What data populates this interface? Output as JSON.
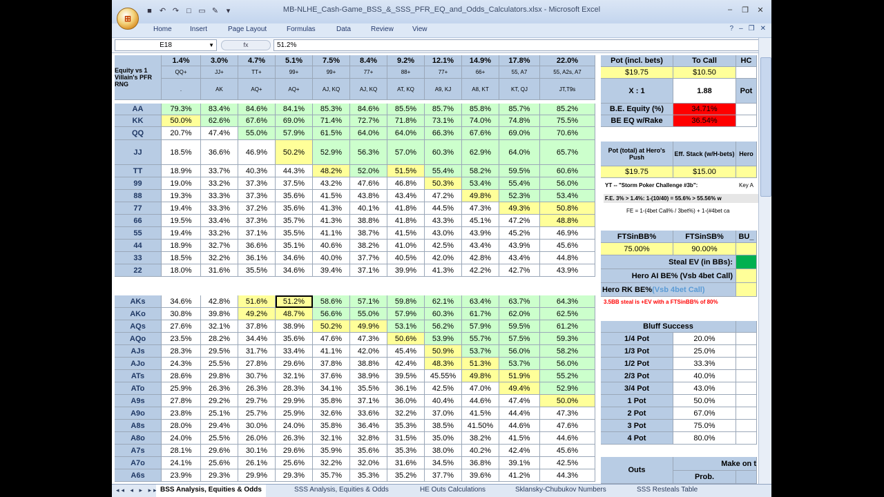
{
  "window": {
    "title": "MB-NLHE_Cash-Game_BSS_&_SSS_PFR_EQ_and_Odds_Calculators.xlsx - Microsoft Excel",
    "office_button": "⊞",
    "minimize": "–",
    "restore": "❐",
    "close": "✕"
  },
  "ribbon": {
    "tabs": [
      "Home",
      "Insert",
      "Page Layout",
      "Formulas",
      "Data",
      "Review",
      "View"
    ],
    "help": "?",
    "ribbon_min": "–",
    "ribbon_restore": "❐",
    "ribbon_close": "✕"
  },
  "formula_bar": {
    "name_box": "E18",
    "fx": "fx",
    "value": "51.2%"
  },
  "main_table": {
    "header_label": "Equity vs 1 Villain's PFR RNG",
    "columns": [
      {
        "pct": "1.4%",
        "r1": "QQ+",
        "r2": "."
      },
      {
        "pct": "3.0%",
        "r1": "JJ+",
        "r2": "AK"
      },
      {
        "pct": "4.7%",
        "r1": "TT+",
        "r2": "AQ+"
      },
      {
        "pct": "5.1%",
        "r1": "99+",
        "r2": "AQ+"
      },
      {
        "pct": "7.5%",
        "r1": "99+",
        "r2": "AJ, KQ"
      },
      {
        "pct": "8.4%",
        "r1": "77+",
        "r2": "AJ, KQ"
      },
      {
        "pct": "9.2%",
        "r1": "88+",
        "r2": "AT, KQ"
      },
      {
        "pct": "12.1%",
        "r1": "77+",
        "r2": "A9, KJ"
      },
      {
        "pct": "14.9%",
        "r1": "66+",
        "r2": "A8, KT"
      },
      {
        "pct": "17.8%",
        "r1": "55, A7",
        "r2": "KT, QJ"
      },
      {
        "pct": "22.0%",
        "r1": "55, A2s, A7",
        "r2": "JT,T9s"
      }
    ],
    "pairs": [
      {
        "hand": "AA",
        "vals": [
          "79.3%",
          "83.4%",
          "84.6%",
          "84.1%",
          "85.3%",
          "84.6%",
          "85.5%",
          "85.7%",
          "85.8%",
          "85.7%",
          "85.2%"
        ],
        "cls": "gggggggggggg"
      },
      {
        "hand": "KK",
        "vals": [
          "50.0%",
          "62.6%",
          "67.6%",
          "69.0%",
          "71.4%",
          "72.7%",
          "71.8%",
          "73.1%",
          "74.0%",
          "74.8%",
          "75.5%"
        ],
        "cls": "ygggggggggg"
      },
      {
        "hand": "QQ",
        "vals": [
          "20.7%",
          "47.4%",
          "55.0%",
          "57.9%",
          "61.5%",
          "64.0%",
          "64.0%",
          "66.3%",
          "67.6%",
          "69.0%",
          "70.6%"
        ],
        "cls": "wwggggggggg"
      },
      {
        "hand": "JJ",
        "vals": [
          "18.5%",
          "36.6%",
          "46.9%",
          "50.2%",
          "52.9%",
          "56.3%",
          "57.0%",
          "60.3%",
          "62.9%",
          "64.0%",
          "65.7%"
        ],
        "cls": "wwwyggggggg"
      },
      {
        "hand": "TT",
        "vals": [
          "18.9%",
          "33.7%",
          "40.3%",
          "44.3%",
          "48.2%",
          "52.0%",
          "51.5%",
          "55.4%",
          "58.2%",
          "59.5%",
          "60.6%"
        ],
        "cls": "wwwwygyggggg"
      },
      {
        "hand": "99",
        "vals": [
          "19.0%",
          "33.2%",
          "37.3%",
          "37.5%",
          "43.2%",
          "47.6%",
          "46.8%",
          "50.3%",
          "53.4%",
          "55.4%",
          "56.0%"
        ],
        "cls": "wwwwwwwyggg"
      },
      {
        "hand": "88",
        "vals": [
          "19.3%",
          "33.3%",
          "37.3%",
          "35.6%",
          "41.5%",
          "43.8%",
          "43.4%",
          "47.2%",
          "49.8%",
          "52.3%",
          "53.4%"
        ],
        "cls": "wwwwwwwwygg"
      },
      {
        "hand": "77",
        "vals": [
          "19.4%",
          "33.3%",
          "37.2%",
          "35.6%",
          "41.3%",
          "40.1%",
          "41.8%",
          "44.5%",
          "47.3%",
          "49.3%",
          "50.8%"
        ],
        "cls": "wwwwwwwwwyy"
      },
      {
        "hand": "66",
        "vals": [
          "19.5%",
          "33.4%",
          "37.3%",
          "35.7%",
          "41.3%",
          "38.8%",
          "41.8%",
          "43.3%",
          "45.1%",
          "47.2%",
          "48.8%"
        ],
        "cls": "wwwwwwwwwwy"
      },
      {
        "hand": "55",
        "vals": [
          "19.4%",
          "33.2%",
          "37.1%",
          "35.5%",
          "41.1%",
          "38.7%",
          "41.5%",
          "43.0%",
          "43.9%",
          "45.2%",
          "46.9%"
        ],
        "cls": "wwwwwwwwwww"
      },
      {
        "hand": "44",
        "vals": [
          "18.9%",
          "32.7%",
          "36.6%",
          "35.1%",
          "40.6%",
          "38.2%",
          "41.0%",
          "42.5%",
          "43.4%",
          "43.9%",
          "45.6%"
        ],
        "cls": "wwwwwwwwwww"
      },
      {
        "hand": "33",
        "vals": [
          "18.5%",
          "32.2%",
          "36.1%",
          "34.6%",
          "40.0%",
          "37.7%",
          "40.5%",
          "42.0%",
          "42.8%",
          "43.4%",
          "44.8%"
        ],
        "cls": "wwwwwwwwwww"
      },
      {
        "hand": "22",
        "vals": [
          "18.0%",
          "31.6%",
          "35.5%",
          "34.6%",
          "39.4%",
          "37.1%",
          "39.9%",
          "41.3%",
          "42.2%",
          "42.7%",
          "43.9%"
        ],
        "cls": "wwwwwwwwwww"
      }
    ],
    "aces": [
      {
        "hand": "AKs",
        "vals": [
          "34.6%",
          "42.8%",
          "51.6%",
          "51.2%",
          "58.6%",
          "57.1%",
          "59.8%",
          "62.1%",
          "63.4%",
          "63.7%",
          "64.3%"
        ],
        "cls": "wwyyggggggg"
      },
      {
        "hand": "AKo",
        "vals": [
          "30.8%",
          "39.8%",
          "49.2%",
          "48.7%",
          "56.6%",
          "55.0%",
          "57.9%",
          "60.3%",
          "61.7%",
          "62.0%",
          "62.5%"
        ],
        "cls": "wwyyggggggg"
      },
      {
        "hand": "AQs",
        "vals": [
          "27.6%",
          "32.1%",
          "37.8%",
          "38.9%",
          "50.2%",
          "49.9%",
          "53.1%",
          "56.2%",
          "57.9%",
          "59.5%",
          "61.2%"
        ],
        "cls": "wwwwyyggggg"
      },
      {
        "hand": "AQo",
        "vals": [
          "23.5%",
          "28.2%",
          "34.4%",
          "35.6%",
          "47.6%",
          "47.3%",
          "50.6%",
          "53.9%",
          "55.7%",
          "57.5%",
          "59.3%"
        ],
        "cls": "wwwwwwygggg"
      },
      {
        "hand": "AJs",
        "vals": [
          "28.3%",
          "29.5%",
          "31.7%",
          "33.4%",
          "41.1%",
          "42.0%",
          "45.4%",
          "50.9%",
          "53.7%",
          "56.0%",
          "58.2%"
        ],
        "cls": "wwwwwwwyggg"
      },
      {
        "hand": "AJo",
        "vals": [
          "24.3%",
          "25.5%",
          "27.8%",
          "29.6%",
          "37.8%",
          "38.8%",
          "42.4%",
          "48.3%",
          "51.3%",
          "53.7%",
          "56.0%"
        ],
        "cls": "wwwwwwwyygg"
      },
      {
        "hand": "ATs",
        "vals": [
          "28.6%",
          "29.8%",
          "30.7%",
          "32.1%",
          "37.6%",
          "38.9%",
          "39.5%",
          "45.55%",
          "49.8%",
          "51.9%",
          "55.2%"
        ],
        "cls": "wwwwwwwwyyg"
      },
      {
        "hand": "ATo",
        "vals": [
          "25.9%",
          "26.3%",
          "26.3%",
          "28.3%",
          "34.1%",
          "35.5%",
          "36.1%",
          "42.5%",
          "47.0%",
          "49.4%",
          "52.9%"
        ],
        "cls": "wwwwwwwwwyg"
      },
      {
        "hand": "A9s",
        "vals": [
          "27.8%",
          "29.2%",
          "29.7%",
          "29.9%",
          "35.8%",
          "37.1%",
          "36.0%",
          "40.4%",
          "44.6%",
          "47.4%",
          "50.0%"
        ],
        "cls": "wwwwwwwwwwy"
      },
      {
        "hand": "A9o",
        "vals": [
          "23.8%",
          "25.1%",
          "25.7%",
          "25.9%",
          "32.6%",
          "33.6%",
          "32.2%",
          "37.0%",
          "41.5%",
          "44.4%",
          "47.3%"
        ],
        "cls": "wwwwwwwwwww"
      },
      {
        "hand": "A8s",
        "vals": [
          "28.0%",
          "29.4%",
          "30.0%",
          "24.0%",
          "35.8%",
          "36.4%",
          "35.3%",
          "38.5%",
          "41.50%",
          "44.6%",
          "47.6%"
        ],
        "cls": "wwwwwwwwwww"
      },
      {
        "hand": "A8o",
        "vals": [
          "24.0%",
          "25.5%",
          "26.0%",
          "26.3%",
          "32.1%",
          "32.8%",
          "31.5%",
          "35.0%",
          "38.2%",
          "41.5%",
          "44.6%"
        ],
        "cls": "wwwwwwwwwww"
      },
      {
        "hand": "A7s",
        "vals": [
          "28.1%",
          "29.6%",
          "30.1%",
          "29.6%",
          "35.9%",
          "35.6%",
          "35.3%",
          "38.0%",
          "40.2%",
          "42.4%",
          "45.6%"
        ],
        "cls": "wwwwwwwwwww"
      },
      {
        "hand": "A7o",
        "vals": [
          "24.1%",
          "25.6%",
          "26.1%",
          "25.6%",
          "32.2%",
          "32.0%",
          "31.6%",
          "34.5%",
          "36.8%",
          "39.1%",
          "42.5%"
        ],
        "cls": "wwwwwwwwwww"
      },
      {
        "hand": "A6s",
        "vals": [
          "23.9%",
          "29.3%",
          "29.9%",
          "29.3%",
          "35.7%",
          "35.3%",
          "35.2%",
          "37.7%",
          "39.6%",
          "41.2%",
          "44.3%"
        ],
        "cls": "wwwwwwwwwww"
      }
    ]
  },
  "right_panel": {
    "pot_label": "Pot (incl. bets)",
    "to_call_label": "To Call",
    "hc_label": "HC",
    "pot_value": "$19.75",
    "to_call_value": "$10.50",
    "x1_label": "X : 1",
    "x1_value": "1.88",
    "pot_short": "Pot",
    "be_equity_label": "B.E. Equity (%)",
    "be_equity_value": "34.71%",
    "be_rake_label": "BE EQ w/Rake",
    "be_rake_value": "36.54%",
    "pot_total_label": "Pot (total) at Hero's Push",
    "eff_stack_label": "Eff. Stack (w/H-bets)",
    "hero_label": "Hero",
    "pot_total_value": "$19.75",
    "eff_stack_value": "$15.00",
    "yt_note": "YT -- \"Storm Poker Challenge #3b\":",
    "key_note": "Key A",
    "fe_note1": "F.E. 3% > 1.4%: 1-(10/40) = 55.6% > 55.56% w",
    "fe_note2": "FE = 1-(4bet Call% / 3bet%) + 1-(#4bet ca",
    "ftsbb_label": "FTSinBB%",
    "ftssb_label": "FTSinSB%",
    "bu_label": "BU_",
    "ftsbb_value": "75.00%",
    "ftssb_value": "90.00%",
    "steal_ev_label": "Steal EV (in BBs):",
    "hero_ai_label": "Hero AI BE% (Vsb 4bet Call)",
    "hero_rk_label": "Hero RK BE%",
    "hero_rk_suffix": "(Vsb 4bet Call)",
    "red_note": "3.5BB steal is +EV with a FTSinBB% of 80%",
    "bluff_title": "Bluff Success",
    "bluff_rows": [
      {
        "label": "1/4 Pot",
        "value": "20.0%"
      },
      {
        "label": "1/3 Pot",
        "value": "25.0%"
      },
      {
        "label": "1/2 Pot",
        "value": "33.3%"
      },
      {
        "label": "2/3 Pot",
        "value": "40.0%"
      },
      {
        "label": "3/4 Pot",
        "value": "43.0%"
      },
      {
        "label": "1 Pot",
        "value": "50.0%"
      },
      {
        "label": "2 Pot",
        "value": "67.0%"
      },
      {
        "label": "3 Pot",
        "value": "75.0%"
      },
      {
        "label": "4 Pot",
        "value": "80.0%"
      }
    ],
    "outs_label": "Outs",
    "make_label": "Make on t",
    "prob_label": "Prob."
  },
  "sheet_tabs": {
    "nav": "◂◂ ◂ ▸ ▸▸",
    "tabs": [
      "BSS Analysis, Equities & Odds",
      "SSS Analysis, Equities & Odds",
      "HE Outs Calculations",
      "Sklansky-Chubukov Numbers",
      "SSS Resteals Table"
    ]
  },
  "colors": {
    "green_cell": "#ccffcc",
    "yellow_cell": "#ffff99",
    "blue_header": "#b8cce4",
    "red_cell": "#ff0000"
  }
}
